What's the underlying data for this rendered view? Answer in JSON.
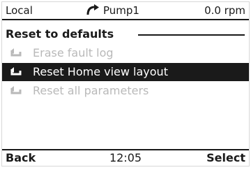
{
  "status_bar": {
    "mode": "Local",
    "drive_name": "Pump1",
    "speed": "0.0 rpm",
    "rotation_icon": "clockwise-arrow-icon"
  },
  "menu": {
    "title": "Reset to defaults",
    "items": [
      {
        "label": "Erase fault log",
        "state": "disabled",
        "icon": "reset-arrow-icon"
      },
      {
        "label": "Reset Home view layout",
        "state": "selected",
        "icon": "reset-arrow-icon"
      },
      {
        "label": "Reset all parameters",
        "state": "disabled",
        "icon": "reset-arrow-icon"
      }
    ]
  },
  "footer": {
    "back_label": "Back",
    "time": "12:05",
    "select_label": "Select"
  },
  "colors": {
    "foreground": "#1a1a1a",
    "background": "#ffffff",
    "disabled": "#b9b9b9"
  }
}
